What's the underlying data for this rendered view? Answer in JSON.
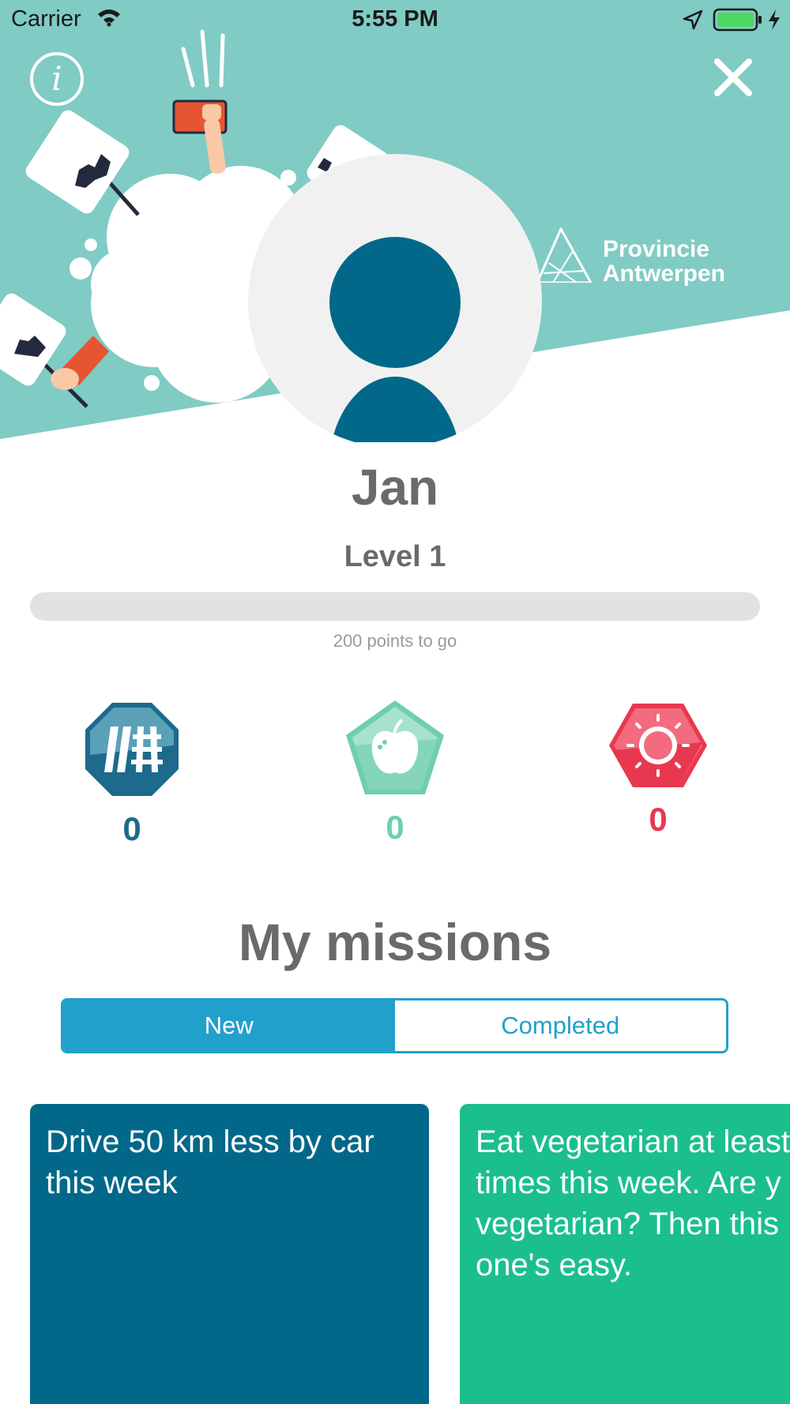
{
  "status_bar": {
    "carrier": "Carrier",
    "time": "5:55 PM"
  },
  "header": {
    "info_icon": "i",
    "brand_line1": "Provincie",
    "brand_line2": "Antwerpen"
  },
  "profile": {
    "name": "Jan",
    "level": "Level 1",
    "progress_fraction": 0,
    "progress_caption": "200 points to go"
  },
  "badges": [
    {
      "icon": "rail-track-icon",
      "count": "0",
      "color": "#1d6a8c"
    },
    {
      "icon": "apple-icon",
      "count": "0",
      "color": "#6fcfac"
    },
    {
      "icon": "sun-icon",
      "count": "0",
      "color": "#e8384f"
    }
  ],
  "missions": {
    "title": "My missions",
    "tabs": {
      "new": "New",
      "completed": "Completed"
    },
    "cards": [
      {
        "line1": "Drive 50 km less by car",
        "line2": "this week"
      },
      {
        "line1": "Eat vegetarian at least",
        "line2": "times this week. Are y",
        "line3": "vegetarian? Then this",
        "line4": "one's easy."
      }
    ]
  }
}
